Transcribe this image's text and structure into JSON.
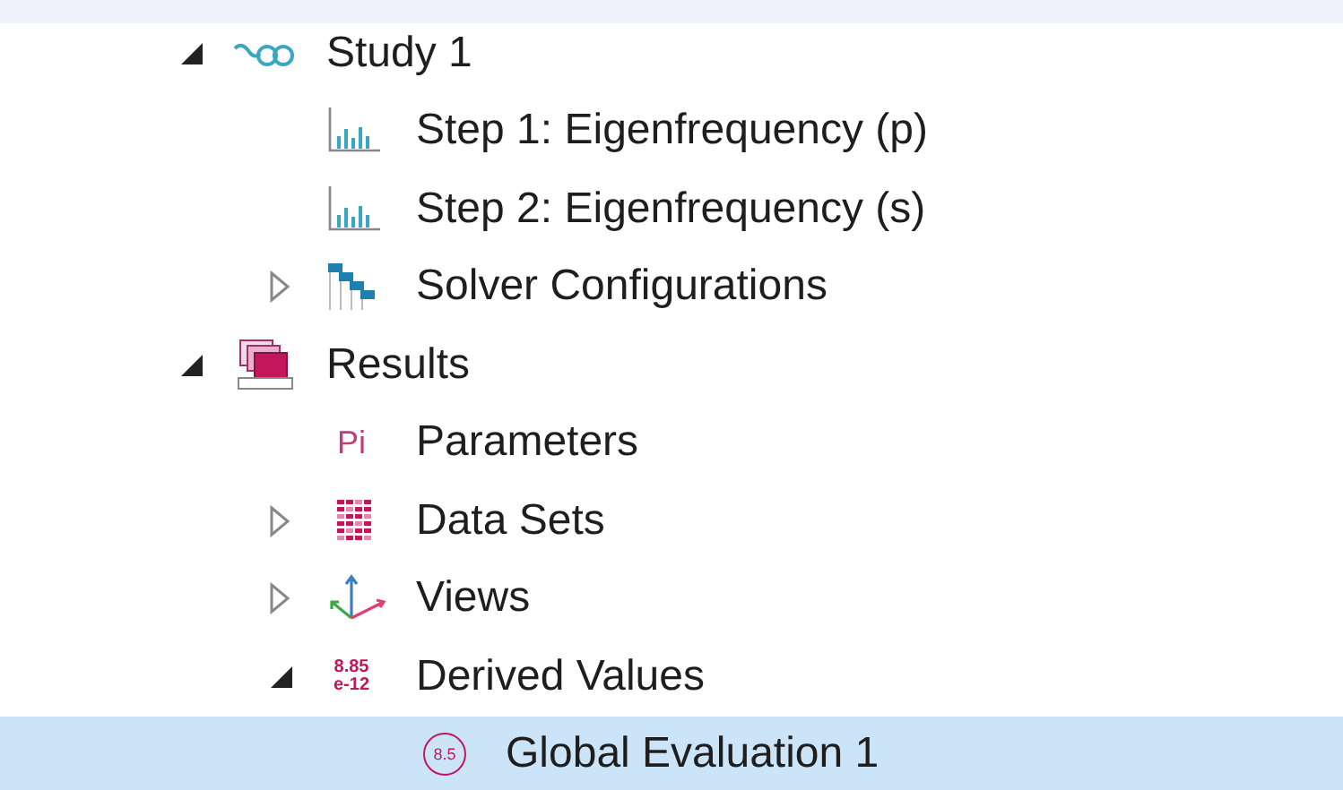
{
  "tree": [
    {
      "label": "Study 1",
      "kind": "study",
      "expanded": true,
      "selected": false,
      "children": [
        {
          "label": "Step 1: Eigenfrequency (p)",
          "kind": "step",
          "selected": false
        },
        {
          "label": "Step 2: Eigenfrequency (s)",
          "kind": "step",
          "selected": false
        },
        {
          "label": "Solver Configurations",
          "kind": "solver",
          "expanded": false,
          "selected": false
        }
      ]
    },
    {
      "label": "Results",
      "kind": "results",
      "expanded": true,
      "selected": false,
      "children": [
        {
          "label": "Parameters",
          "kind": "parameters",
          "icon_text": "Pi",
          "selected": false
        },
        {
          "label": "Data Sets",
          "kind": "datasets",
          "expanded": false,
          "selected": false
        },
        {
          "label": "Views",
          "kind": "views",
          "expanded": false,
          "selected": false
        },
        {
          "label": "Derived Values",
          "kind": "derived",
          "icon_text": "8.85",
          "icon_text_2": "e-12",
          "expanded": true,
          "selected": false,
          "children": [
            {
              "label": "Global Evaluation 1",
              "kind": "global",
              "icon_text": "8.5",
              "selected": true
            }
          ]
        }
      ]
    }
  ]
}
